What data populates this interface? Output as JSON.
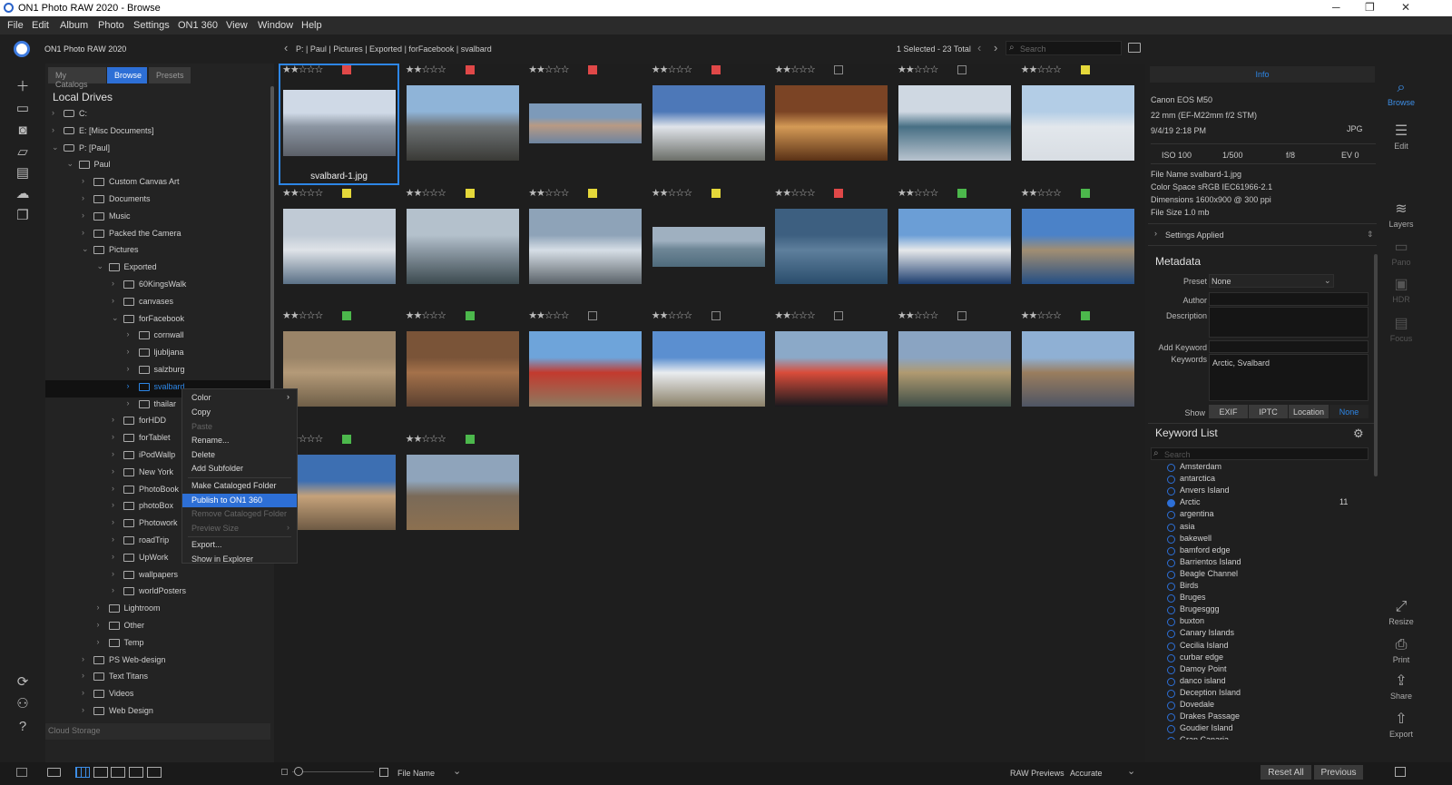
{
  "window": {
    "title": "ON1 Photo RAW 2020 - Browse",
    "min": "─",
    "max": "❐",
    "close": "✕"
  },
  "menu": [
    "File",
    "Edit",
    "Album",
    "Photo",
    "Settings",
    "ON1 360",
    "View",
    "Window",
    "Help"
  ],
  "app": {
    "name": "ON1 Photo RAW 2020"
  },
  "breadcrumb": "P:  |  Paul  |  Pictures  |  Exported  |  forFacebook  |  svalbard",
  "selection_count": "1 Selected - 23 Total",
  "search_placeholder": "Search",
  "tabs": {
    "catalogs": "My Catalogs",
    "browse": "Browse",
    "presets": "Presets"
  },
  "local_drives": "Local Drives",
  "tree": [
    {
      "label": "C:",
      "depth": 0,
      "drive": true,
      "open": false
    },
    {
      "label": "E: [Misc Documents]",
      "depth": 0,
      "drive": true,
      "open": false
    },
    {
      "label": "P: [Paul]",
      "depth": 0,
      "drive": true,
      "open": true
    },
    {
      "label": "Paul",
      "depth": 1,
      "open": true
    },
    {
      "label": "Custom Canvas Art",
      "depth": 2
    },
    {
      "label": "Documents",
      "depth": 2
    },
    {
      "label": "Music",
      "depth": 2
    },
    {
      "label": "Packed the Camera",
      "depth": 2
    },
    {
      "label": "Pictures",
      "depth": 2,
      "open": true
    },
    {
      "label": "Exported",
      "depth": 3,
      "open": true
    },
    {
      "label": "60KingsWalk",
      "depth": 4
    },
    {
      "label": "canvases",
      "depth": 4
    },
    {
      "label": "forFacebook",
      "depth": 4,
      "open": true
    },
    {
      "label": "cornwall",
      "depth": 5
    },
    {
      "label": "ljubljana",
      "depth": 5
    },
    {
      "label": "salzburg",
      "depth": 5
    },
    {
      "label": "svalbard",
      "depth": 5,
      "selected": true
    },
    {
      "label": "thailar",
      "depth": 5
    },
    {
      "label": "forHDD",
      "depth": 4
    },
    {
      "label": "forTablet",
      "depth": 4
    },
    {
      "label": "iPodWallp",
      "depth": 4
    },
    {
      "label": "New York",
      "depth": 4
    },
    {
      "label": "PhotoBook",
      "depth": 4
    },
    {
      "label": "photoBox",
      "depth": 4
    },
    {
      "label": "Photowork",
      "depth": 4
    },
    {
      "label": "roadTrip",
      "depth": 4
    },
    {
      "label": "UpWork",
      "depth": 4
    },
    {
      "label": "wallpapers",
      "depth": 4
    },
    {
      "label": "worldPosters",
      "depth": 4
    },
    {
      "label": "Lightroom",
      "depth": 3
    },
    {
      "label": "Other",
      "depth": 3
    },
    {
      "label": "Temp",
      "depth": 3
    },
    {
      "label": "PS Web-design",
      "depth": 2
    },
    {
      "label": "Text Titans",
      "depth": 2
    },
    {
      "label": "Videos",
      "depth": 2
    },
    {
      "label": "Web Design",
      "depth": 2
    }
  ],
  "cloud_storage": "Cloud Storage",
  "context_menu": [
    {
      "label": "Color",
      "arrow": true
    },
    {
      "label": "Copy"
    },
    {
      "label": "Paste",
      "disabled": true
    },
    {
      "label": "Rename..."
    },
    {
      "label": "Delete"
    },
    {
      "label": "Add Subfolder"
    },
    {
      "sep": true
    },
    {
      "label": "Make Cataloged Folder"
    },
    {
      "label": "Publish to ON1 360",
      "selected": true
    },
    {
      "label": "Remove Cataloged Folder",
      "disabled": true
    },
    {
      "label": "Preview Size",
      "arrow": true,
      "disabled": true
    },
    {
      "sep": true
    },
    {
      "label": "Export..."
    },
    {
      "label": "Show in Explorer"
    }
  ],
  "photos": [
    {
      "stars": 2,
      "label": "#e04848",
      "colors": [
        "#cfd9e6",
        "#8c96a3",
        "#5c6068"
      ],
      "selected": true,
      "name": "svalbard-1.jpg"
    },
    {
      "stars": 2,
      "label": "#e04848",
      "colors": [
        "#8fb4d8",
        "#6d7274",
        "#3a3a36"
      ]
    },
    {
      "stars": 2,
      "label": "#e04848",
      "colors": [
        "#7d9ab9",
        "#b89a84",
        "#6d84a0"
      ],
      "short": true
    },
    {
      "stars": 2,
      "label": "#e04848",
      "colors": [
        "#4d78b8",
        "#e0e4ea",
        "#6b6e68"
      ]
    },
    {
      "stars": 2,
      "label": "none",
      "colors": [
        "#7b4425",
        "#d49a56",
        "#5a3116"
      ]
    },
    {
      "stars": 2,
      "label": "none",
      "colors": [
        "#cfd8e2",
        "#476f84",
        "#b9c4cf"
      ]
    },
    {
      "stars": 2,
      "label": "#e5d83a",
      "colors": [
        "#b3cde6",
        "#e2e7ec",
        "#d8dde3"
      ]
    },
    {
      "stars": 2,
      "label": "#e5d83a",
      "colors": [
        "#c0cad5",
        "#dfe3e8",
        "#5a7086"
      ]
    },
    {
      "stars": 2,
      "label": "#e5d83a",
      "colors": [
        "#b4c1cc",
        "#8d9aa5",
        "#3c4a4f"
      ]
    },
    {
      "stars": 2,
      "label": "#e5d83a",
      "colors": [
        "#8ea3b8",
        "#d6dee6",
        "#5a6268"
      ]
    },
    {
      "stars": 2,
      "label": "#e5d83a",
      "colors": [
        "#9fb0c0",
        "#6f8797",
        "#4f6b7c"
      ],
      "short": true
    },
    {
      "stars": 2,
      "label": "#e04848",
      "colors": [
        "#3d5f80",
        "#5e7f9c",
        "#2a4d6c"
      ]
    },
    {
      "stars": 2,
      "label": "#4cb84c",
      "colors": [
        "#6b9ed6",
        "#e6e8ea",
        "#1c3d6e"
      ]
    },
    {
      "stars": 2,
      "label": "#4cb84c",
      "colors": [
        "#4b82c8",
        "#a18e72",
        "#244e84"
      ]
    },
    {
      "stars": 2,
      "label": "#4cb84c",
      "colors": [
        "#9a8468",
        "#b49a78",
        "#6f5f48"
      ]
    },
    {
      "stars": 2,
      "label": "#4cb84c",
      "colors": [
        "#7a5438",
        "#a4714a",
        "#5a4030"
      ]
    },
    {
      "stars": 2,
      "label": "none",
      "colors": [
        "#6ea4da",
        "#c33a2e",
        "#8c7a60"
      ]
    },
    {
      "stars": 2,
      "label": "none",
      "colors": [
        "#5b8fd0",
        "#e9ecef",
        "#8a8068"
      ]
    },
    {
      "stars": 2,
      "label": "none",
      "colors": [
        "#8ba9c8",
        "#d94c3a",
        "#1a1a1e"
      ]
    },
    {
      "stars": 2,
      "label": "none",
      "colors": [
        "#8aa4c2",
        "#b09a70",
        "#3f4e48"
      ]
    },
    {
      "stars": 2,
      "label": "#4cb84c",
      "colors": [
        "#8fb0d4",
        "#9a7d5e",
        "#4e5564"
      ]
    },
    {
      "stars": 2,
      "label": "#4cb84c",
      "colors": [
        "#3d6fb2",
        "#c5a27a",
        "#6e5a44"
      ]
    },
    {
      "stars": 2,
      "label": "#4cb84c",
      "colors": [
        "#8fa4bb",
        "#7a6a58",
        "#8c7050"
      ]
    }
  ],
  "info": {
    "tab": "Info",
    "camera": "Canon EOS M50",
    "lens": "22 mm (EF-M22mm f/2 STM)",
    "date": "9/4/19 2:18 PM",
    "format": "JPG",
    "iso": "ISO 100",
    "shutter": "1/500",
    "aperture": "f/8",
    "ev": "EV 0",
    "file_name": "File Name   svalbard-1.jpg",
    "color_space": "Color Space sRGB IEC61966-2.1",
    "dimensions": "Dimensions 1600x900 @ 300 ppi",
    "file_size": "File Size     1.0 mb",
    "settings_applied": "Settings Applied"
  },
  "metadata": {
    "title": "Metadata",
    "preset_label": "Preset",
    "preset_value": "None",
    "author_label": "Author",
    "description_label": "Description",
    "add_keyword_label": "Add Keyword",
    "keywords_label": "Keywords",
    "keywords_value": "Arctic, Svalbard",
    "show_label": "Show",
    "show_tabs": [
      "EXIF",
      "IPTC",
      "Location",
      "None"
    ]
  },
  "keyword_list": {
    "title": "Keyword List",
    "search_placeholder": "Search",
    "items": [
      {
        "label": "Amsterdam"
      },
      {
        "label": "antarctica"
      },
      {
        "label": "Anvers Island"
      },
      {
        "label": "Arctic",
        "on": true,
        "count": "11"
      },
      {
        "label": "argentina"
      },
      {
        "label": "asia"
      },
      {
        "label": "bakewell"
      },
      {
        "label": "bamford edge"
      },
      {
        "label": "Barrientos Island"
      },
      {
        "label": "Beagle Channel"
      },
      {
        "label": "Birds"
      },
      {
        "label": "Bruges"
      },
      {
        "label": "Brugesggg"
      },
      {
        "label": "buxton"
      },
      {
        "label": "Canary Islands"
      },
      {
        "label": "Cecilia Island"
      },
      {
        "label": "curbar edge"
      },
      {
        "label": "Damoy Point"
      },
      {
        "label": "danco island"
      },
      {
        "label": "Deception Island"
      },
      {
        "label": "Dovedale"
      },
      {
        "label": "Drakes Passage"
      },
      {
        "label": "Goudier Island"
      },
      {
        "label": "Gran Canaria"
      }
    ]
  },
  "right_tools": [
    {
      "label": "Browse",
      "glyph": "⌕",
      "active": true
    },
    {
      "label": "Edit",
      "glyph": "☰"
    },
    {
      "label": "Layers",
      "glyph": "≋"
    },
    {
      "label": "Pano",
      "glyph": "▭",
      "dim": true
    },
    {
      "label": "HDR",
      "glyph": "▣",
      "dim": true
    },
    {
      "label": "Focus",
      "glyph": "▤",
      "dim": true
    },
    {
      "label": "Resize",
      "glyph": "⤢"
    },
    {
      "label": "Print",
      "glyph": "⎙"
    },
    {
      "label": "Share",
      "glyph": "⇪"
    },
    {
      "label": "Export",
      "glyph": "⇧"
    }
  ],
  "bottom": {
    "sort_label": "File Name",
    "raw_previews_label": "RAW Previews",
    "raw_previews_value": "Accurate",
    "reset_all": "Reset All",
    "previous": "Previous"
  },
  "colors": {
    "accent": "#2d6fd6",
    "selection_border": "#2d86e6"
  }
}
